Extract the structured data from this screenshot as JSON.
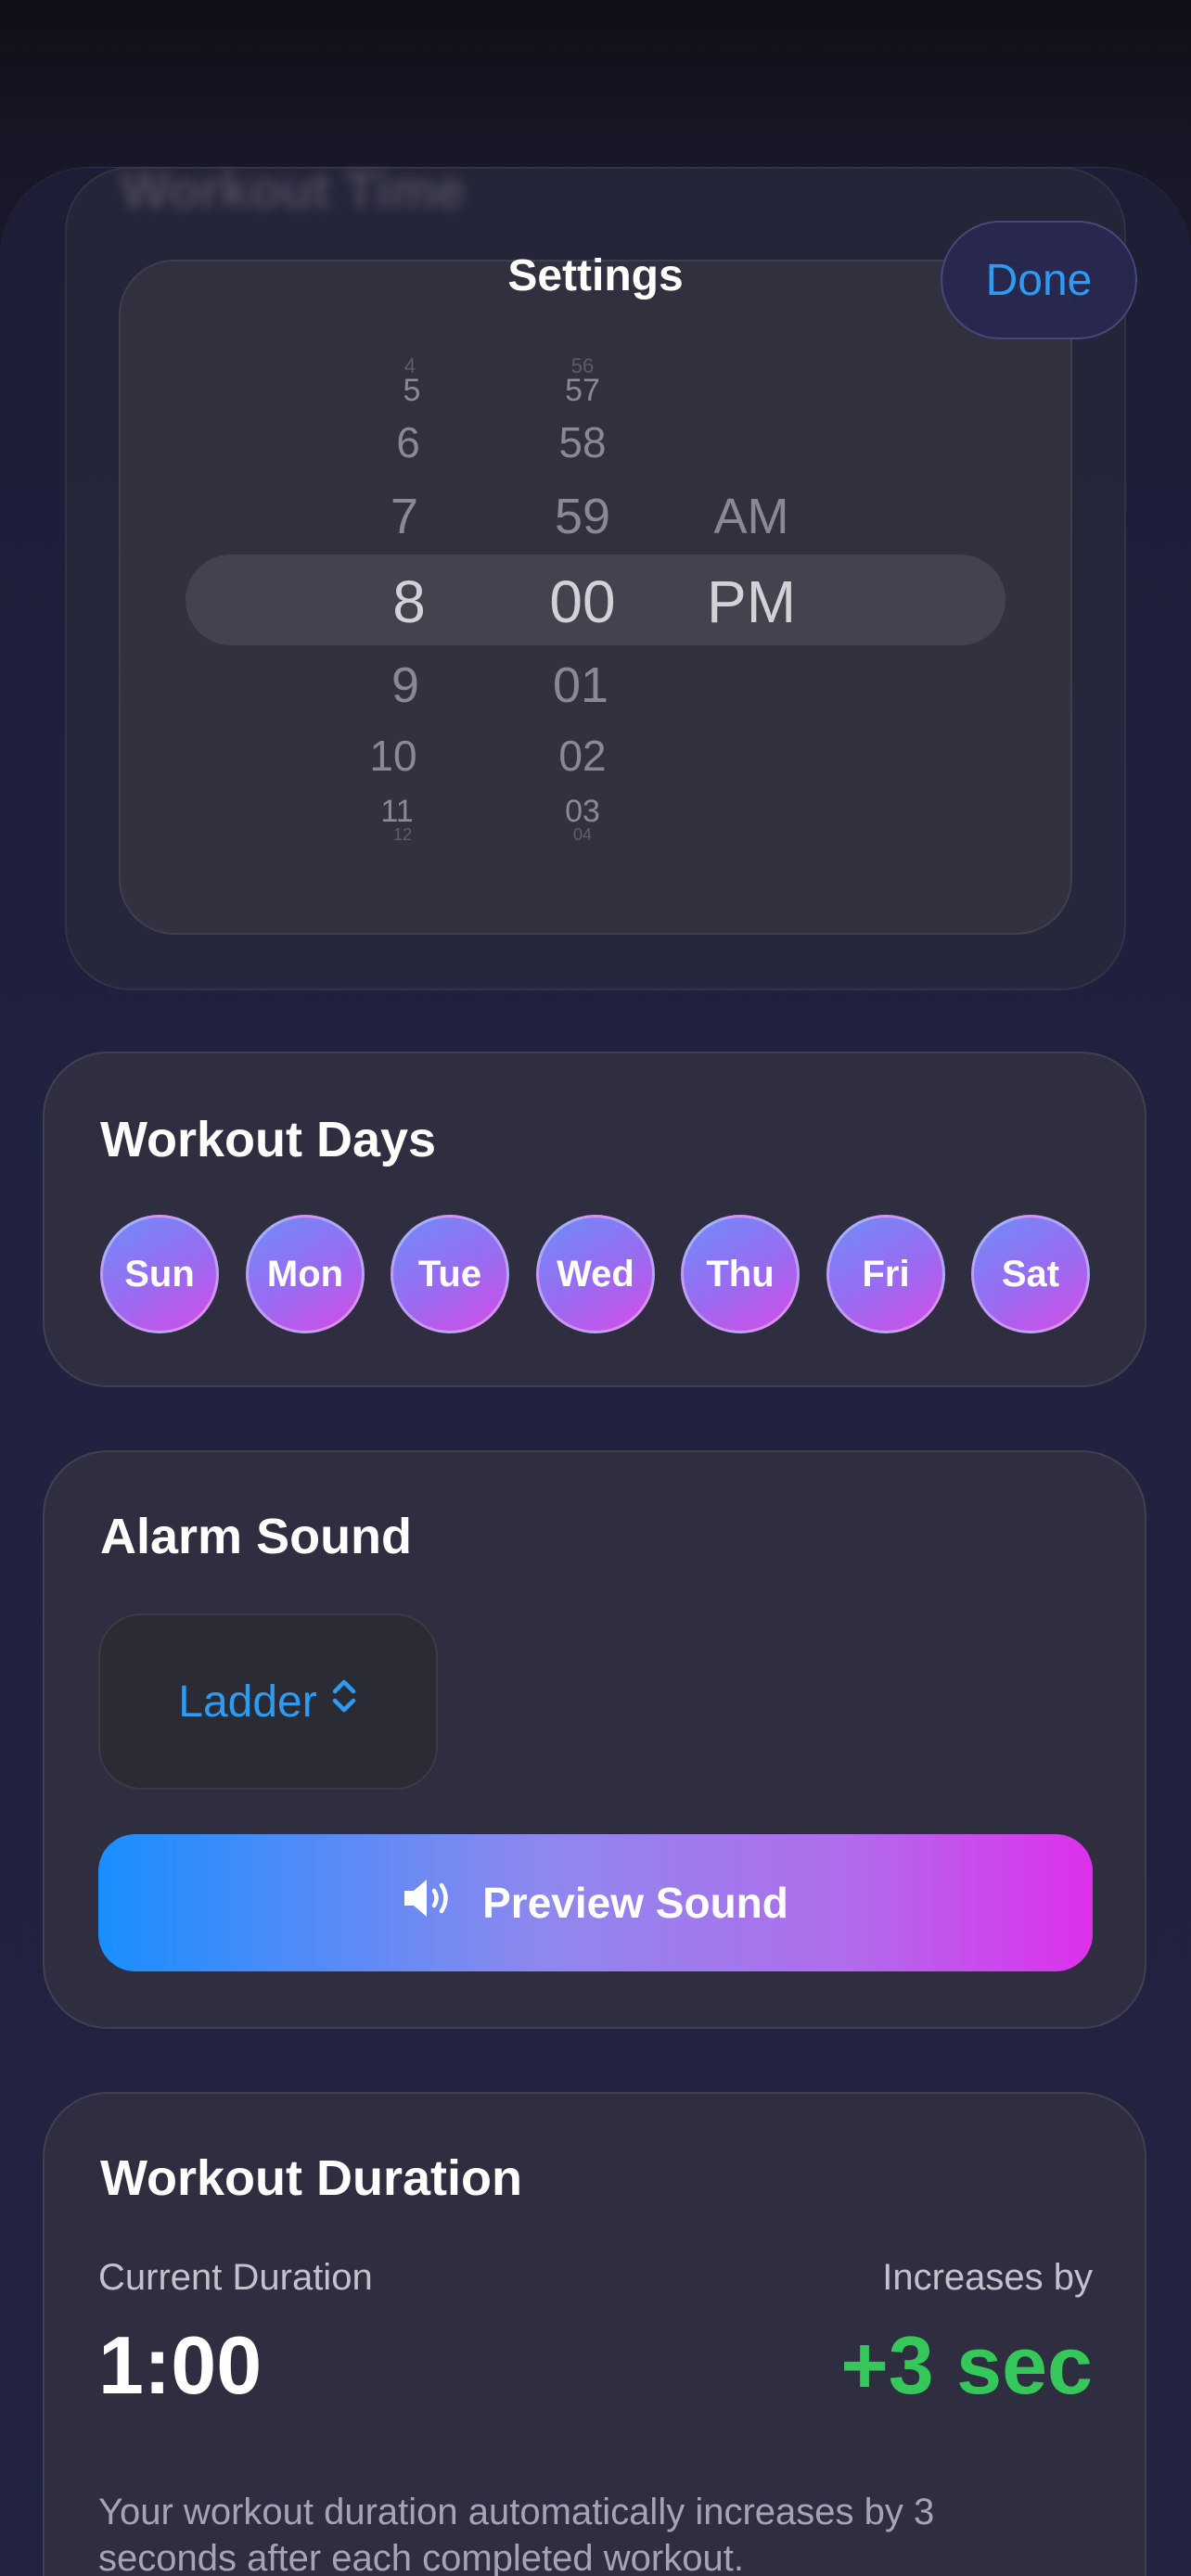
{
  "header": {
    "title": "Settings",
    "done_label": "Done"
  },
  "workout_time": {
    "title": "Workout Time",
    "hours": [
      "4",
      "5",
      "6",
      "7",
      "8",
      "9",
      "10",
      "11",
      "12"
    ],
    "minutes": [
      "56",
      "57",
      "58",
      "59",
      "00",
      "01",
      "02",
      "03",
      "04"
    ],
    "periods": [
      "AM",
      "PM"
    ],
    "selected": {
      "hour": "8",
      "minute": "00",
      "period": "PM"
    }
  },
  "workout_days": {
    "title": "Workout Days",
    "days": [
      "Sun",
      "Mon",
      "Tue",
      "Wed",
      "Thu",
      "Fri",
      "Sat"
    ]
  },
  "alarm_sound": {
    "title": "Alarm Sound",
    "selected_sound": "Ladder",
    "preview_label": "Preview Sound"
  },
  "workout_duration": {
    "title": "Workout Duration",
    "current_label": "Current Duration",
    "current_value": "1:00",
    "increase_label": "Increases by",
    "increase_value": "+3 sec",
    "description": "Your workout duration automatically increases by 3 seconds after each completed workout."
  },
  "colors": {
    "accent_blue": "#2e9bf2",
    "success_green": "#35c759",
    "gradient_start": "#1a8eff",
    "gradient_end": "#dd30ec"
  }
}
